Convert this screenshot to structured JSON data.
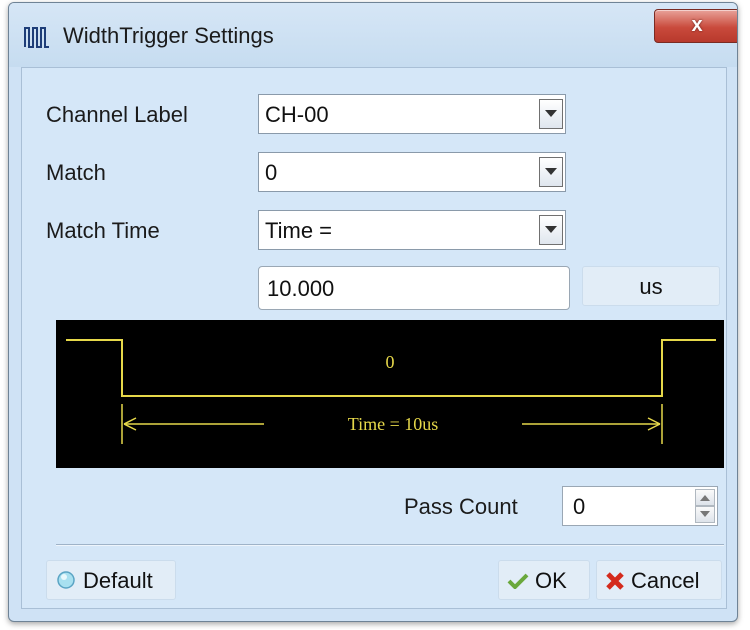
{
  "window": {
    "title": "WidthTrigger Settings",
    "app_icon": "pulse-wave-icon",
    "close_label": "x"
  },
  "form": {
    "channel_label": {
      "label": "Channel Label",
      "value": "CH-00"
    },
    "match": {
      "label": "Match",
      "value": "0"
    },
    "match_time": {
      "label": "Match Time",
      "value": "Time ="
    },
    "time_value": "10.000",
    "unit_label": "us"
  },
  "diagram": {
    "level_label": "0",
    "time_label": "Time = 10us",
    "trace_color": "#e6d84a",
    "background": "#000000"
  },
  "pass_count": {
    "label": "Pass Count",
    "value": "0"
  },
  "buttons": {
    "default_label": "Default",
    "ok_label": "OK",
    "cancel_label": "Cancel",
    "ok_color": "#6aa83c",
    "cancel_color": "#d42a1c"
  }
}
